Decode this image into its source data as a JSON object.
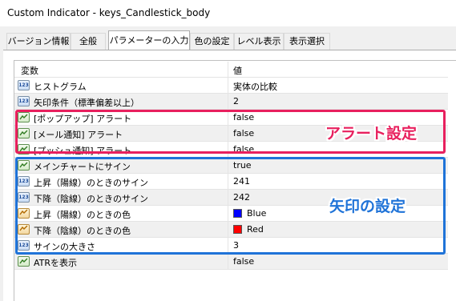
{
  "window": {
    "title": "Custom Indicator - keys_Candlestick_body"
  },
  "tabs": [
    {
      "label": "バージョン情報"
    },
    {
      "label": "全般"
    },
    {
      "label": "パラメーターの入力",
      "active": true
    },
    {
      "label": "色の設定"
    },
    {
      "label": "レベル表示"
    },
    {
      "label": "表示選択"
    }
  ],
  "table": {
    "headers": {
      "variable": "変数",
      "value": "値"
    },
    "rows": [
      {
        "icon": "number-icon",
        "name": "ヒストグラム",
        "value": "実体の比較"
      },
      {
        "icon": "number-icon",
        "name": "矢印条件（標準偏差以上）",
        "value": "2"
      },
      {
        "icon": "bool-icon",
        "name": "[ポップアップ] アラート",
        "value": "false"
      },
      {
        "icon": "bool-icon",
        "name": "[メール通知] アラート",
        "value": "false"
      },
      {
        "icon": "bool-icon",
        "name": "[プッシュ通知] アラート",
        "value": "false"
      },
      {
        "icon": "bool-icon",
        "name": "メインチャートにサイン",
        "value": "true"
      },
      {
        "icon": "number-icon",
        "name": "上昇（陽線）のときのサイン",
        "value": "241"
      },
      {
        "icon": "number-icon",
        "name": "下降（陰線）のときのサイン",
        "value": "242"
      },
      {
        "icon": "color-icon",
        "name": "上昇（陽線）のときの色",
        "value": "Blue",
        "swatch": "#0000ff"
      },
      {
        "icon": "color-icon",
        "name": "下降（陰線）のときの色",
        "value": "Red",
        "swatch": "#ff0000"
      },
      {
        "icon": "number-icon",
        "name": "サインの大きさ",
        "value": "3"
      },
      {
        "icon": "bool-icon",
        "name": "ATRを表示",
        "value": "false"
      }
    ],
    "number_icon_text": "123"
  },
  "annotations": {
    "alert": {
      "label": "アラート設定",
      "color": "#e8205e"
    },
    "arrow": {
      "label": "矢印の設定",
      "color": "#1f73d8"
    }
  }
}
